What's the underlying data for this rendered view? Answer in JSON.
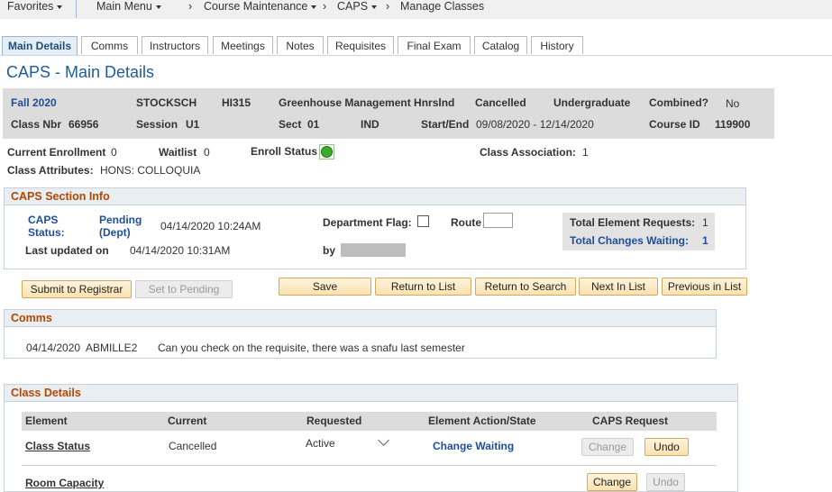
{
  "topnav": {
    "favorites": "Favorites",
    "main_menu": "Main Menu",
    "breadcrumbs": [
      "Course Maintenance",
      "CAPS",
      "Manage Classes"
    ]
  },
  "tabs": [
    "Main Details",
    "Comms",
    "Instructors",
    "Meetings",
    "Notes",
    "Requisites",
    "Final Exam",
    "Catalog",
    "History"
  ],
  "page_title": "CAPS - Main Details",
  "header": {
    "term": "Fall 2020",
    "institution": "STOCKSCH",
    "course": "HI315",
    "title": "Greenhouse Management Hnrslnd",
    "status": "Cancelled",
    "career": "Undergraduate",
    "combined_label": "Combined?",
    "combined_value": "No",
    "class_nbr_label": "Class Nbr",
    "class_nbr": "66956",
    "session_label": "Session",
    "session": "U1",
    "sect_label": "Sect",
    "sect": "01",
    "component": "IND",
    "start_end_label": "Start/End",
    "start_end": "09/08/2020 - 12/14/2020",
    "course_id_label": "Course ID",
    "course_id": "119900"
  },
  "enrollment": {
    "current_label": "Current Enrollment",
    "current": "0",
    "waitlist_label": "Waitlist",
    "waitlist": "0",
    "enroll_status_label": "Enroll Status",
    "assoc_label": "Class Association:",
    "assoc": "1",
    "attributes_label": "Class Attributes:",
    "attributes": "HONS: COLLOQUIA"
  },
  "caps_section": {
    "title": "CAPS Section Info",
    "status_label_1": "CAPS",
    "status_label_2": "Status:",
    "status_value_1": "Pending",
    "status_value_2": "(Dept)",
    "status_date": "04/14/2020 10:24AM",
    "last_updated_label": "Last updated on",
    "last_updated": "04/14/2020 10:31AM",
    "dept_flag_label": "Department Flag:",
    "route_label": "Route",
    "by_label": "by",
    "total_requests_label": "Total Element Requests:",
    "total_requests": "1",
    "total_changes_label": "Total Changes Waiting:",
    "total_changes": "1"
  },
  "buttons": {
    "submit": "Submit to Registrar",
    "set_pending": "Set to Pending",
    "save": "Save",
    "return_list": "Return to List",
    "return_search": "Return to Search",
    "next": "Next In List",
    "previous": "Previous in List"
  },
  "comms": {
    "title": "Comms",
    "date": "04/14/2020",
    "user": "ABMILLE2",
    "message": "Can you check on the requisite, there was a snafu last semester"
  },
  "class_details": {
    "title": "Class Details",
    "columns": [
      "Element",
      "Current",
      "Requested",
      "Element Action/State",
      "CAPS Request"
    ],
    "rows": [
      {
        "element": "Class Status",
        "current": "Cancelled",
        "requested": "Active",
        "action": "Change Waiting",
        "change": "Change",
        "undo": "Undo"
      },
      {
        "element": "Room Capacity",
        "current": "",
        "requested": "",
        "action": "",
        "change": "Change",
        "undo": "Undo"
      }
    ]
  },
  "colors": {
    "link_blue": "#1f4e9a",
    "section_orange": "#b34700",
    "status_green": "#3aae2a"
  }
}
